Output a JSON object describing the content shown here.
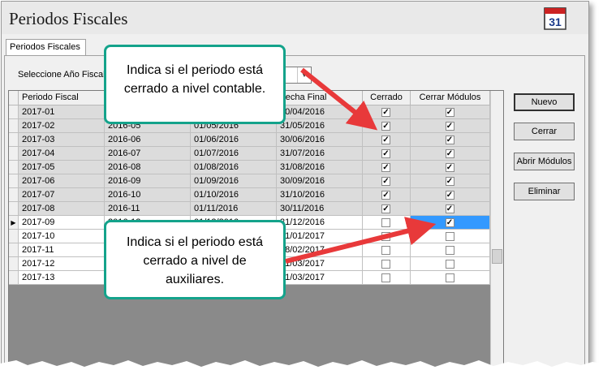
{
  "window": {
    "title": "Periodos Fiscales",
    "icon": "calendar-icon",
    "calendar_day": "31"
  },
  "tab": {
    "label": "Periodos Fiscales"
  },
  "year_selector": {
    "label": "Seleccione Año Fiscal",
    "value": ""
  },
  "grid": {
    "columns": [
      "Periodo Fiscal",
      "",
      "",
      "Fecha Final",
      "Cerrado",
      "Cerrar Módulos"
    ],
    "current_row_marker": "▶",
    "rows": [
      {
        "periodo": "2017-01",
        "ref": "",
        "inicio": "",
        "final": "30/04/2016",
        "cerrado": true,
        "modulos": true
      },
      {
        "periodo": "2017-02",
        "ref": "2016-05",
        "inicio": "01/05/2016",
        "final": "31/05/2016",
        "cerrado": true,
        "modulos": true
      },
      {
        "periodo": "2017-03",
        "ref": "2016-06",
        "inicio": "01/06/2016",
        "final": "30/06/2016",
        "cerrado": true,
        "modulos": true
      },
      {
        "periodo": "2017-04",
        "ref": "2016-07",
        "inicio": "01/07/2016",
        "final": "31/07/2016",
        "cerrado": true,
        "modulos": true
      },
      {
        "periodo": "2017-05",
        "ref": "2016-08",
        "inicio": "01/08/2016",
        "final": "31/08/2016",
        "cerrado": true,
        "modulos": true
      },
      {
        "periodo": "2017-06",
        "ref": "2016-09",
        "inicio": "01/09/2016",
        "final": "30/09/2016",
        "cerrado": true,
        "modulos": true
      },
      {
        "periodo": "2017-07",
        "ref": "2016-10",
        "inicio": "01/10/2016",
        "final": "31/10/2016",
        "cerrado": true,
        "modulos": true
      },
      {
        "periodo": "2017-08",
        "ref": "2016-11",
        "inicio": "01/11/2016",
        "final": "30/11/2016",
        "cerrado": true,
        "modulos": true
      },
      {
        "periodo": "2017-09",
        "ref": "2016-12",
        "inicio": "01/12/2016",
        "final": "31/12/2016",
        "cerrado": false,
        "modulos": true
      },
      {
        "periodo": "2017-10",
        "ref": "",
        "inicio": "",
        "final": "31/01/2017",
        "cerrado": false,
        "modulos": false
      },
      {
        "periodo": "2017-11",
        "ref": "",
        "inicio": "",
        "final": "28/02/2017",
        "cerrado": false,
        "modulos": false
      },
      {
        "periodo": "2017-12",
        "ref": "",
        "inicio": "",
        "final": "31/03/2017",
        "cerrado": false,
        "modulos": false
      },
      {
        "periodo": "2017-13",
        "ref": "",
        "inicio": "",
        "final": "31/03/2017",
        "cerrado": false,
        "modulos": false
      }
    ],
    "current_row_index": 8
  },
  "buttons": {
    "nuevo": "Nuevo",
    "cerrar": "Cerrar",
    "abrir_modulos": "Abrir Módulos",
    "eliminar": "Eliminar"
  },
  "callouts": {
    "top": [
      "Indica si el periodo está",
      "cerrado a nivel contable."
    ],
    "bottom": [
      "Indica si el periodo está",
      "cerrado a nivel de",
      "auxiliares."
    ]
  },
  "colors": {
    "callout_border": "#14a38b",
    "arrow": "#e8393a",
    "selection": "#3399ff",
    "closed_row": "#dcdcdc"
  }
}
